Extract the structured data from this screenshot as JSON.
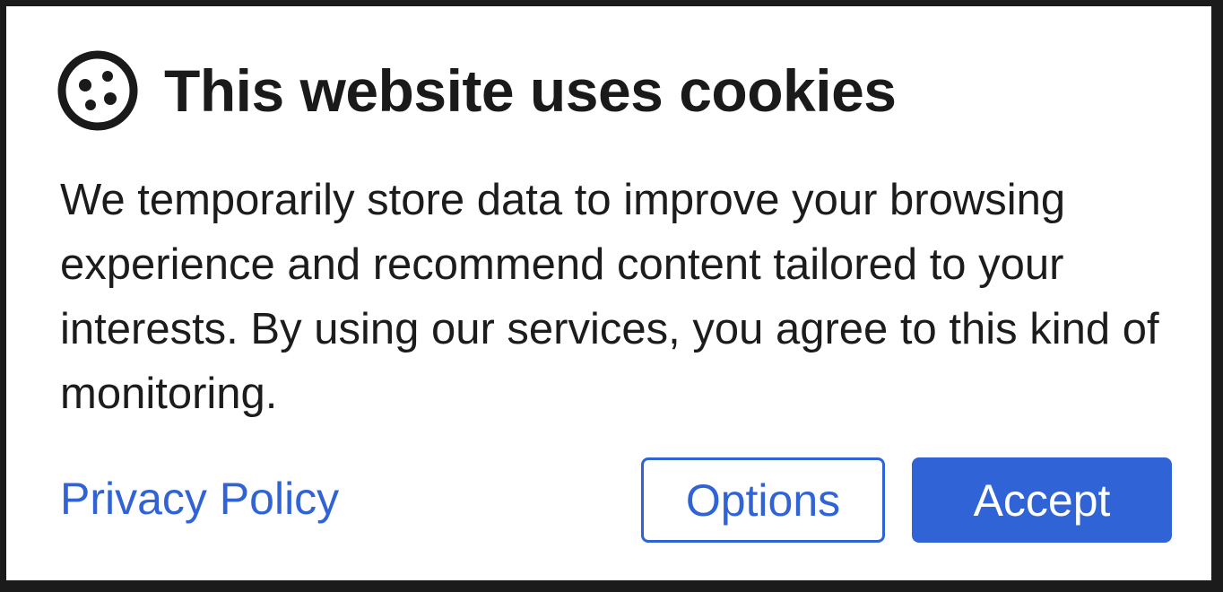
{
  "banner": {
    "title": "This website uses cookies",
    "icon": "cookie-icon",
    "body": "We temporarily store data to improve your browsing experience and recommend content tailored to your interests. By using our services, you agree to this kind of monitoring.",
    "privacy_link_label": "Privacy Policy",
    "options_label": "Options",
    "accept_label": "Accept"
  },
  "colors": {
    "accent": "#2f63d6",
    "text": "#1c1c1c",
    "background": "#ffffff",
    "frame": "#1b1b1b"
  }
}
